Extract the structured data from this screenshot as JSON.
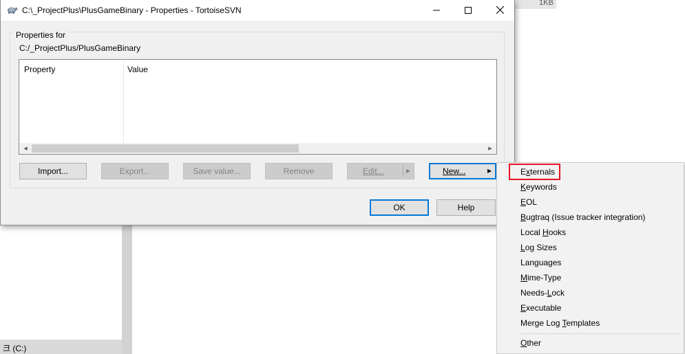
{
  "background": {
    "size_text": "1KB",
    "drive_label": "크 (C:)"
  },
  "dialog": {
    "title": "C:\\_ProjectPlus\\PlusGameBinary - Properties - TortoiseSVN",
    "minimize_icon": "minimize-icon",
    "maximize_icon": "maximize-icon",
    "close_icon": "close-icon",
    "group_label": "Properties for",
    "path": "C:/_ProjectPlus/PlusGameBinary",
    "columns": [
      "Property",
      "Value"
    ],
    "buttons": {
      "import": "Import...",
      "export": "Export...",
      "save_value": "Save value...",
      "remove": "Remove",
      "edit": "Edit...",
      "new": "New...",
      "ok": "OK",
      "help": "Help"
    }
  },
  "menu": {
    "items": [
      {
        "label": "Externals",
        "access": "x"
      },
      {
        "label": "Keywords",
        "access": "K"
      },
      {
        "label": "EOL",
        "access": "E"
      },
      {
        "label": "Bugtraq (Issue tracker integration)",
        "access": "B"
      },
      {
        "label": "Local Hooks",
        "access": "H"
      },
      {
        "label": "Log Sizes",
        "access": "L"
      },
      {
        "label": "Languages",
        "access": ""
      },
      {
        "label": "Mime-Type",
        "access": "M"
      },
      {
        "label": "Needs-Lock",
        "access": "L"
      },
      {
        "label": "Executable",
        "access": "E"
      },
      {
        "label": "Merge Log Templates",
        "access": "T"
      },
      {
        "label": "Other",
        "access": "O"
      }
    ],
    "highlighted": "Externals",
    "highlight_color": "#e81123"
  },
  "colors": {
    "accent": "#0078d7",
    "dialog_bg": "#f0f0f0"
  }
}
